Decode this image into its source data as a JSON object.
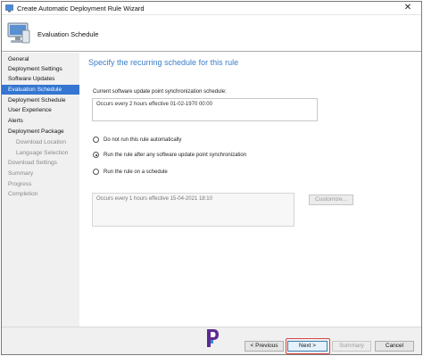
{
  "window": {
    "title": "Create Automatic Deployment Rule Wizard",
    "close_glyph": "✕"
  },
  "header": {
    "title": "Evaluation Schedule"
  },
  "sidebar": {
    "items": [
      {
        "label": "General",
        "state": "normal",
        "level": 0
      },
      {
        "label": "Deployment Settings",
        "state": "normal",
        "level": 0
      },
      {
        "label": "Software Updates",
        "state": "normal",
        "level": 0
      },
      {
        "label": "Evaluation Schedule",
        "state": "active",
        "level": 0
      },
      {
        "label": "Deployment Schedule",
        "state": "normal",
        "level": 0
      },
      {
        "label": "User Experience",
        "state": "normal",
        "level": 0
      },
      {
        "label": "Alerts",
        "state": "normal",
        "level": 0
      },
      {
        "label": "Deployment Package",
        "state": "normal",
        "level": 0
      },
      {
        "label": "Download Location",
        "state": "muted",
        "level": 1
      },
      {
        "label": "Language Selection",
        "state": "muted",
        "level": 1
      },
      {
        "label": "Download Settings",
        "state": "muted",
        "level": 0
      },
      {
        "label": "Summary",
        "state": "muted",
        "level": 0
      },
      {
        "label": "Progress",
        "state": "muted",
        "level": 0
      },
      {
        "label": "Completion",
        "state": "muted",
        "level": 0
      }
    ]
  },
  "main": {
    "heading": "Specify the recurring schedule for this rule",
    "current_label": "Current software update point synchronization schedule:",
    "current_schedule": "Occurs every 2 hours effective 01-02-1970 00:00",
    "options": [
      {
        "label": "Do not run this rule automatically",
        "checked": false
      },
      {
        "label": "Run the rule after any software update point synchronization",
        "checked": true
      },
      {
        "label": "Run the rule on a schedule",
        "checked": false
      }
    ],
    "schedule_text": "Occurs every 1 hours effective 15-04-2021 18:10",
    "customize_label": "Customize..."
  },
  "footer": {
    "prev_label": "< Previous",
    "next_label": "Next >",
    "summary_label": "Summary",
    "cancel_label": "Cancel"
  },
  "colors": {
    "accent": "#3476d1",
    "heading": "#3b7dc9",
    "highlight": "#d64848"
  }
}
